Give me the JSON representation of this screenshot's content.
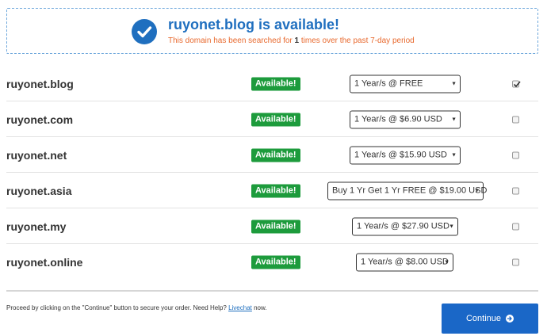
{
  "banner": {
    "title": "ruyonet.blog is available!",
    "sub_prefix": "This domain has been searched for ",
    "sub_count": "1",
    "sub_suffix": " times over the past 7-day period",
    "icon": "check-circle-icon"
  },
  "results": [
    {
      "domain": "ruyonet.blog",
      "status": "Available!",
      "option": "1 Year/s @ FREE",
      "selected": true
    },
    {
      "domain": "ruyonet.com",
      "status": "Available!",
      "option": "1 Year/s @ $6.90 USD",
      "selected": false
    },
    {
      "domain": "ruyonet.net",
      "status": "Available!",
      "option": "1 Year/s @ $15.90 USD",
      "selected": false
    },
    {
      "domain": "ruyonet.asia",
      "status": "Available!",
      "option": "Buy 1 Yr Get 1 Yr FREE @ $19.00 USD",
      "selected": false
    },
    {
      "domain": "ruyonet.my",
      "status": "Available!",
      "option": "1 Year/s @ $27.90 USD",
      "selected": false
    },
    {
      "domain": "ruyonet.online",
      "status": "Available!",
      "option": "1 Year/s @ $8.00 USD",
      "selected": false
    }
  ],
  "dropdown_arrow": "▼",
  "footer": {
    "text_before": "Proceed by clicking on the \"Continue\" button to secure your order. Need Help? ",
    "link": "Livechat",
    "text_after": " now."
  },
  "continue_button": {
    "label": "Continue",
    "icon": "arrow-right-circle-icon"
  },
  "colors": {
    "accent": "#1f6fbf",
    "available_badge": "#1d9b3c",
    "notice": "#e8692e",
    "button": "#1a67c7"
  }
}
